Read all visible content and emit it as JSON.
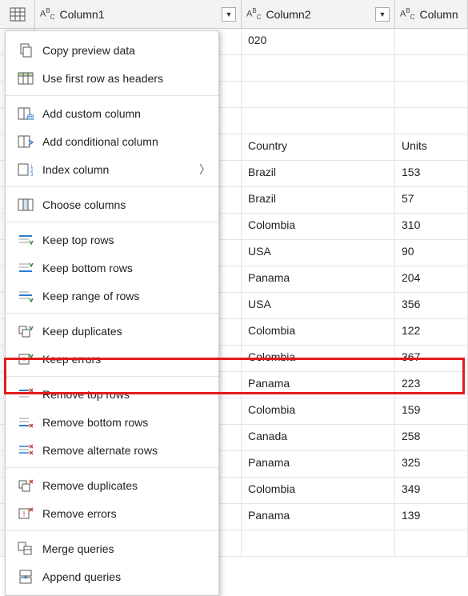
{
  "columns": {
    "col1_label": "Column1",
    "col2_label": "Column2",
    "col3_label": "Column"
  },
  "grid_rows": [
    {
      "c1": "",
      "c2": "020",
      "c3": ""
    },
    {
      "c1": "",
      "c2": "",
      "c3": ""
    },
    {
      "c1": "",
      "c2": "",
      "c3": ""
    },
    {
      "c1": "",
      "c2": "",
      "c3": ""
    },
    {
      "c1": "",
      "c2": "Country",
      "c3": "Units"
    },
    {
      "c1": "",
      "c2": "Brazil",
      "c3": "153"
    },
    {
      "c1": "",
      "c2": "Brazil",
      "c3": "57"
    },
    {
      "c1": "",
      "c2": "Colombia",
      "c3": "310"
    },
    {
      "c1": "",
      "c2": "USA",
      "c3": "90"
    },
    {
      "c1": "",
      "c2": "Panama",
      "c3": "204"
    },
    {
      "c1": "",
      "c2": "USA",
      "c3": "356"
    },
    {
      "c1": "",
      "c2": "Colombia",
      "c3": "122"
    },
    {
      "c1": "",
      "c2": "Colombia",
      "c3": "367"
    },
    {
      "c1": "",
      "c2": "Panama",
      "c3": "223"
    },
    {
      "c1": "",
      "c2": "Colombia",
      "c3": "159"
    },
    {
      "c1": "",
      "c2": "Canada",
      "c3": "258"
    },
    {
      "c1": "",
      "c2": "Panama",
      "c3": "325"
    },
    {
      "c1": "",
      "c2": "Colombia",
      "c3": "349"
    },
    {
      "c1": "",
      "c2": "Panama",
      "c3": "139"
    },
    {
      "c1": "",
      "c2": "",
      "c3": ""
    }
  ],
  "menu": {
    "copy_preview": "Copy preview data",
    "first_row_headers": "Use first row as headers",
    "add_custom": "Add custom column",
    "add_conditional": "Add conditional column",
    "index_column": "Index column",
    "choose_columns": "Choose columns",
    "keep_top": "Keep top rows",
    "keep_bottom": "Keep bottom rows",
    "keep_range": "Keep range of rows",
    "keep_duplicates": "Keep duplicates",
    "keep_errors": "Keep errors",
    "remove_top": "Remove top rows",
    "remove_bottom": "Remove bottom rows",
    "remove_alternate": "Remove alternate rows",
    "remove_duplicates": "Remove duplicates",
    "remove_errors": "Remove errors",
    "merge_queries": "Merge queries",
    "append_queries": "Append queries"
  },
  "highlighted_item": "remove_top"
}
